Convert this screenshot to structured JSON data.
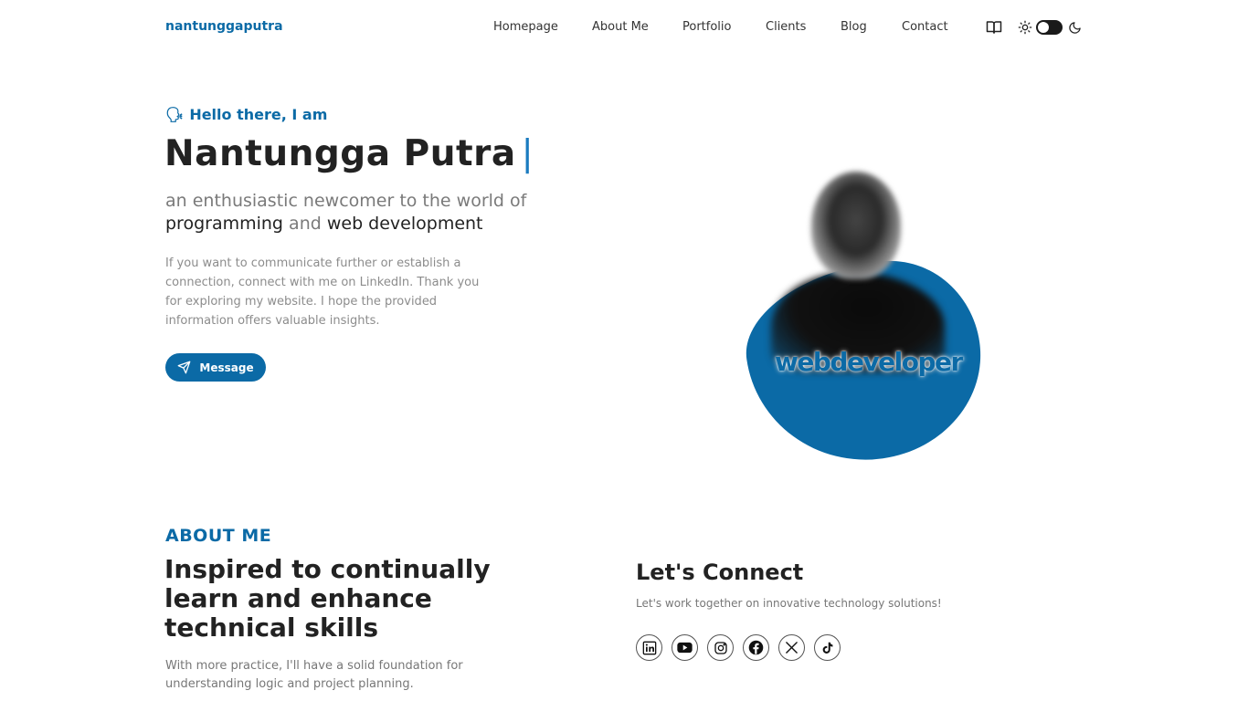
{
  "brand": "nantunggaputra",
  "nav": {
    "items": [
      "Homepage",
      "About Me",
      "Portfolio",
      "Clients",
      "Blog",
      "Contact"
    ],
    "book_icon": "book-open-icon",
    "theme": {
      "light_icon": "sun-icon",
      "dark_icon": "moon-icon",
      "state": "light"
    }
  },
  "hero": {
    "greeting_emoji": "🗣",
    "greeting": "Hello there, I am",
    "name": "Nantungga Putra",
    "cursor": "|",
    "tagline_prefix": "an enthusiastic newcomer to the world of",
    "tagline_word1": "programming",
    "tagline_and": "and",
    "tagline_word2": "web development",
    "intro": "If you want to communicate further or establish a connection, connect with me on LinkedIn. Thank you for exploring my website. I hope the provided information offers valuable insights.",
    "message_button": "Message",
    "art_text": "webdeveloper"
  },
  "about": {
    "label": "ABOUT ME",
    "heading": "Inspired to continually learn and enhance technical skills",
    "text": "With more practice, I'll have a solid foundation for understanding logic and project planning."
  },
  "connect": {
    "title": "Let's Connect",
    "subtitle": "Let's work together on innovative technology solutions!",
    "socials": [
      "linkedin-icon",
      "youtube-icon",
      "instagram-icon",
      "facebook-icon",
      "x-icon",
      "tiktok-icon"
    ]
  },
  "colors": {
    "accent": "#0b6aa6",
    "text": "#222222",
    "muted": "#7a7a7a"
  }
}
